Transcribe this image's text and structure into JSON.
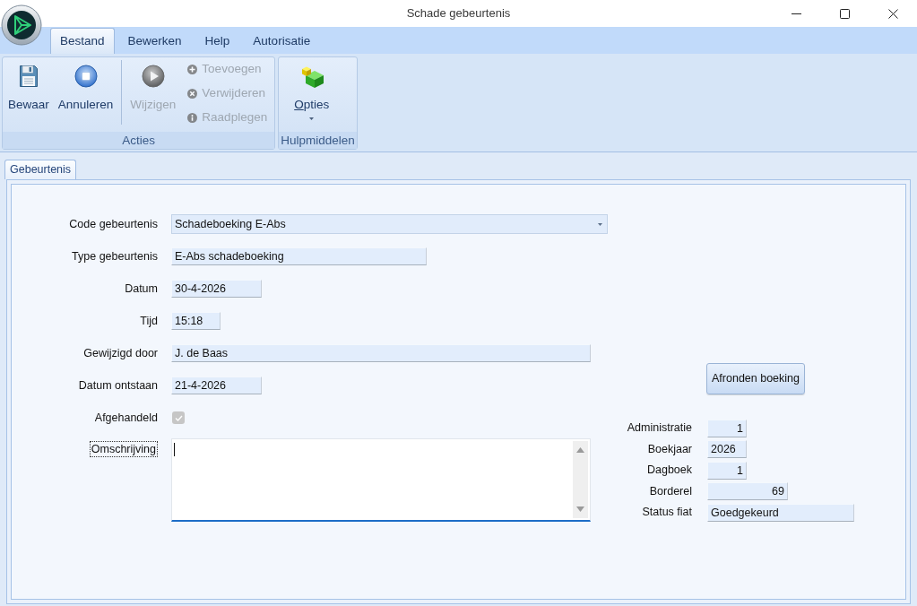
{
  "window": {
    "title": "Schade gebeurtenis"
  },
  "menu_tabs": [
    {
      "label": "Bestand",
      "selected": true
    },
    {
      "label": "Bewerken",
      "selected": false
    },
    {
      "label": "Help",
      "selected": false
    },
    {
      "label": "Autorisatie",
      "selected": false
    }
  ],
  "ribbon": {
    "groups": [
      {
        "label": "Acties",
        "items": [
          {
            "kind": "large",
            "label": "Bewaar",
            "disabled": false
          },
          {
            "kind": "large",
            "label": "Annuleren",
            "disabled": false
          },
          {
            "kind": "separator"
          },
          {
            "kind": "large",
            "label": "Wijzigen",
            "disabled": true
          },
          {
            "kind": "small",
            "label": "Toevoegen",
            "disabled": true
          },
          {
            "kind": "small",
            "label": "Verwijderen",
            "disabled": true
          },
          {
            "kind": "small",
            "label": "Raadplegen",
            "disabled": true
          }
        ]
      },
      {
        "label": "Hulpmiddelen",
        "items": [
          {
            "kind": "dropdown",
            "label": "Opties",
            "disabled": false
          }
        ]
      }
    ]
  },
  "form_tab": {
    "label": "Gebeurtenis",
    "selected": true
  },
  "fields": [
    {
      "kind": "dropdown",
      "label": "Code gebeurtenis",
      "value": "Schadeboeking E-Abs"
    },
    {
      "kind": "text",
      "label": "Type gebeurtenis",
      "value": "E-Abs schadeboeking"
    },
    {
      "kind": "text",
      "label": "Datum",
      "value": "30-4-2026"
    },
    {
      "kind": "text",
      "label": "Tijd",
      "value": "15:18"
    },
    {
      "kind": "text",
      "label": "Gewijzigd door",
      "value": "J. de Baas"
    },
    {
      "kind": "text",
      "label": "Datum ontstaan",
      "value": "21-4-2026"
    },
    {
      "kind": "checkbox",
      "label": "Afgehandeld",
      "checked": true,
      "disabled": true
    },
    {
      "kind": "textarea",
      "label": "Omschrijving",
      "focused": true
    }
  ],
  "action_button": {
    "label": "Afronden boeking"
  },
  "details": [
    {
      "kind": "number",
      "label": "Administratie",
      "value": "1"
    },
    {
      "kind": "text",
      "label": "Boekjaar",
      "value": "2026"
    },
    {
      "kind": "number",
      "label": "Dagboek",
      "value": "1"
    },
    {
      "kind": "number",
      "label": "Borderel",
      "value": "69"
    },
    {
      "kind": "text",
      "label": "Status fiat",
      "value": "Goedgekeurd"
    }
  ]
}
